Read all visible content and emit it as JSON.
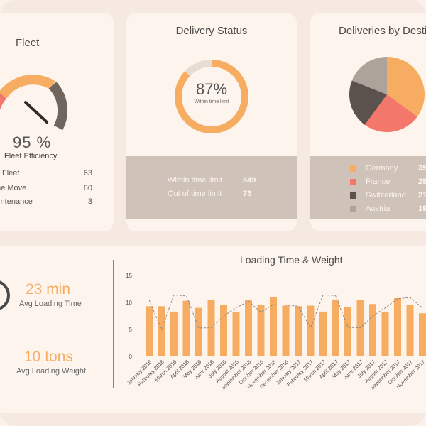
{
  "fleet": {
    "title": "Fleet",
    "efficiency_value": "95 %",
    "efficiency_label": "Fleet Efficiency",
    "gauge_fraction": 0.95,
    "rows": [
      {
        "label": "Fleet",
        "value": "63"
      },
      {
        "label": "me Move",
        "value": "60"
      },
      {
        "label": "aintenance",
        "value": "3"
      }
    ]
  },
  "delivery_status": {
    "title": "Delivery Status",
    "percent": "87%",
    "percent_label": "Within time limit",
    "ring_fraction": 0.87,
    "rows": [
      {
        "label": "Within time limit",
        "value": "549"
      },
      {
        "label": "Out of time limit",
        "value": "73"
      }
    ]
  },
  "destinations": {
    "title": "Deliveries by Destin",
    "items": [
      {
        "name": "Germany",
        "value": "35",
        "color": "#f6ad62"
      },
      {
        "name": "France",
        "value": "25",
        "color": "#f3776b"
      },
      {
        "name": "Switzerland",
        "value": "21",
        "color": "#5c524d"
      },
      {
        "name": "Austria",
        "value": "19",
        "color": "#aea39b"
      }
    ]
  },
  "loading": {
    "time_value": "23 min",
    "time_label": "Avg Loading Time",
    "weight_value": "10 tons",
    "weight_label": "Avg Loading Weight"
  },
  "colors": {
    "accent": "#f6ad62",
    "red": "#f3776b",
    "dark": "#5c524d",
    "grey": "#aea39b",
    "panel": "#fdf4ee"
  },
  "chart_data": {
    "type": "bar",
    "title": "Loading Time & Weight",
    "categories": [
      "January 2016",
      "February 2016",
      "March 2016",
      "April 2016",
      "May 2016",
      "June 2016",
      "July 2016",
      "August 2016",
      "September 2016",
      "October 2016",
      "November 2016",
      "December 2016",
      "January 2017",
      "February 2017",
      "March 2017",
      "April 2017",
      "May 2017",
      "June 2017",
      "July 2017",
      "August 2017",
      "September 2017",
      "October 2017",
      "November 2017"
    ],
    "series": [
      {
        "values": [
          9.3,
          9.3,
          8.3,
          10.3,
          9.0,
          10.5,
          9.6,
          8.3,
          10.5,
          9.6,
          11.0,
          9.4,
          9.3,
          9.4,
          8.3,
          10.5,
          9.2,
          10.5,
          9.7,
          8.3,
          10.8,
          9.6,
          8.0
        ]
      },
      {
        "type": "line",
        "values": [
          10.5,
          5.0,
          11.4,
          11.2,
          5.3,
          5.3,
          7.5,
          9.0,
          10.2,
          8.2,
          9.6,
          9.5,
          9.3,
          5.3,
          11.4,
          11.3,
          5.4,
          5.3,
          7.5,
          9.0,
          10.7,
          10.9,
          9.0
        ]
      }
    ],
    "yticks": [
      "0",
      "5",
      "10",
      "15"
    ],
    "ylim": [
      0,
      15
    ]
  }
}
